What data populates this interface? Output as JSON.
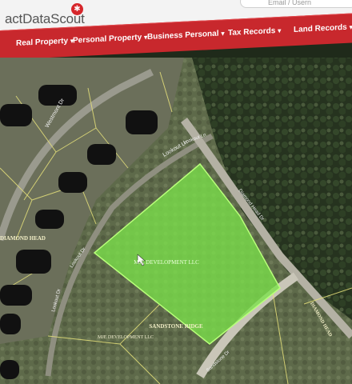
{
  "app": {
    "logo_text": "actDataScout",
    "logo_mark": "✱",
    "search_placeholder": "Email / Usern"
  },
  "nav": {
    "items": [
      {
        "label": "Real Property"
      },
      {
        "label": "Personal Property"
      },
      {
        "label": "Business Personal"
      },
      {
        "label": "Tax Records"
      },
      {
        "label": "Land Records"
      }
    ],
    "caret": "▾"
  },
  "map": {
    "roads": {
      "westmont": "Westmont Dr",
      "lookout_ln": "Lookout Ln",
      "lookout_ln_2": "Lookout Ln",
      "lookout_dr": "Lookout Dr",
      "sandstone_dr": "Sandstone Dr",
      "diamond_dr": "Diamond Head Dr",
      "lookout_dr_2": "Lookout Dr"
    },
    "parcels": {
      "highlighted_owner": "MJE DEVELOPMENT LLC",
      "lower_owner": "MJE DEVELOPMENT LLC",
      "subdivision": "SANDSTONE RIDGE",
      "diamond_head_left": "DIAMOND HEAD",
      "diamond_head_right": "DIAMOND HEAD"
    }
  },
  "colors": {
    "nav": "#c8282d",
    "parcel_fill": "#7be24a",
    "parcel_stroke": "#b8ff7a"
  }
}
